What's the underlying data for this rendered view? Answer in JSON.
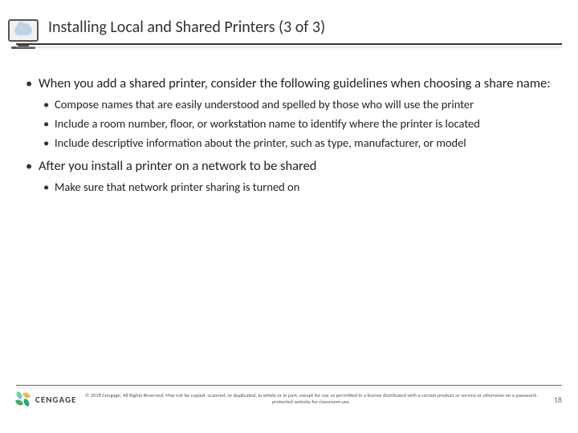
{
  "header": {
    "title": "Installing Local and Shared Printers (3 of 3)"
  },
  "content": {
    "b1a": "When you add a shared printer, consider the following guidelines when choosing a share name:",
    "b2a": "Compose names that are easily understood and spelled by those who will use the printer",
    "b2b": "Include a room number, floor, or workstation name to identify where the printer is located",
    "b2c": "Include descriptive information about the printer, such as type, manufacturer, or model",
    "b1b": "After you install a printer on a network to be shared",
    "b2d": "Make sure that network printer sharing is turned on"
  },
  "footer": {
    "brand": "CENGAGE",
    "copyright": "© 2018 Cengage. All Rights Reserved. May not be copied, scanned, or duplicated, in whole or in part, except for use as permitted in a license distributed with a certain product or service or otherwise on a password-protected website for classroom use.",
    "page": "18"
  }
}
